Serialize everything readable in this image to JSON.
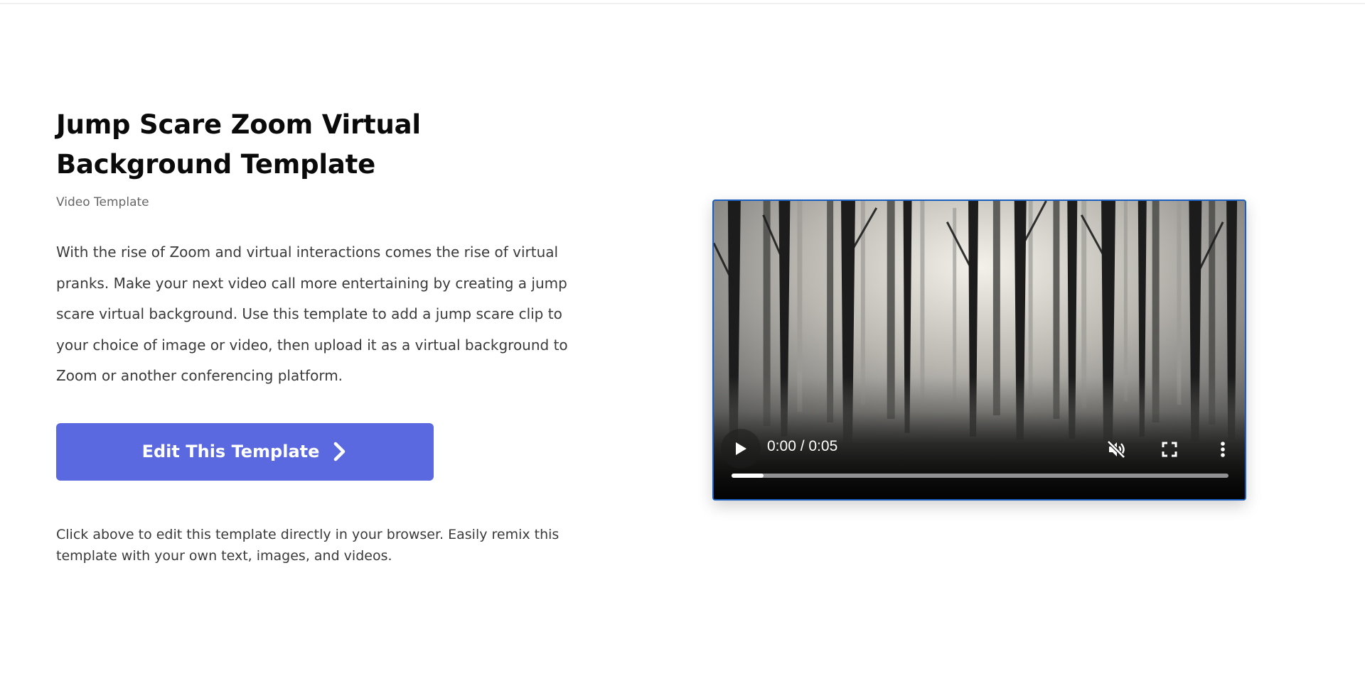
{
  "template": {
    "title": "Jump Scare Zoom Virtual Background Template",
    "subtitle": "Video Template",
    "description": "With the rise of Zoom and virtual interactions comes the rise of virtual pranks. Make your next video call more entertaining by creating a jump scare virtual background. Use this template to add a jump scare clip to your choice of image or video, then upload it as a virtual background to Zoom or another conferencing platform.",
    "edit_button_label": "Edit This Template",
    "helper_text": "Click above to edit this template directly in your browser. Easily remix this template with your own text, images, and videos."
  },
  "video_player": {
    "time_display": "0:00 / 0:05",
    "progress": 0.065,
    "muted": true,
    "icons": [
      "play-icon",
      "mute-icon",
      "fullscreen-icon",
      "more-options-icon"
    ]
  },
  "colors": {
    "accent_button": "#5b69e0",
    "video_border": "#1a5fc0"
  }
}
